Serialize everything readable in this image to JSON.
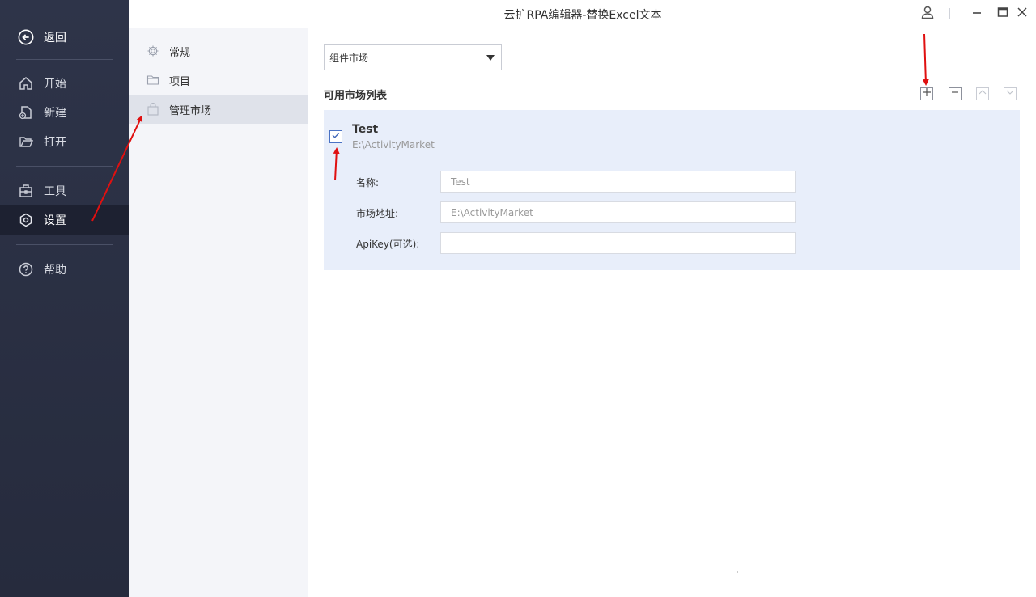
{
  "window": {
    "title": "云扩RPA编辑器-替换Excel文本"
  },
  "left_nav": {
    "back_label": "返回",
    "items": [
      {
        "label": "开始",
        "icon": "home-icon"
      },
      {
        "label": "新建",
        "icon": "new-file-icon"
      },
      {
        "label": "打开",
        "icon": "open-folder-icon"
      },
      {
        "label": "工具",
        "icon": "toolbox-icon"
      },
      {
        "label": "设置",
        "icon": "settings-hex-icon",
        "active": true
      },
      {
        "label": "帮助",
        "icon": "help-icon"
      }
    ]
  },
  "settings_nav": {
    "items": [
      {
        "label": "常规",
        "icon": "gear-icon"
      },
      {
        "label": "项目",
        "icon": "folder-icon"
      },
      {
        "label": "管理市场",
        "icon": "shopping-bag-icon",
        "active": true
      }
    ]
  },
  "content": {
    "dropdown_value": "组件市场",
    "list_title": "可用市场列表",
    "market": {
      "name": "Test",
      "path": "E:\\ActivityMarket",
      "checked": true,
      "fields": [
        {
          "label": "名称:",
          "value": "Test"
        },
        {
          "label": "市场地址:",
          "value": "E:\\ActivityMarket"
        },
        {
          "label": "ApiKey(可选):",
          "value": ""
        }
      ]
    }
  },
  "colors": {
    "sidebar_bg": "#2e3449",
    "sidebar_active": "#1d2131",
    "settings_nav_bg": "#f4f5f9",
    "card_bg": "#e8eefa",
    "annotation_arrow": "#e01010"
  }
}
